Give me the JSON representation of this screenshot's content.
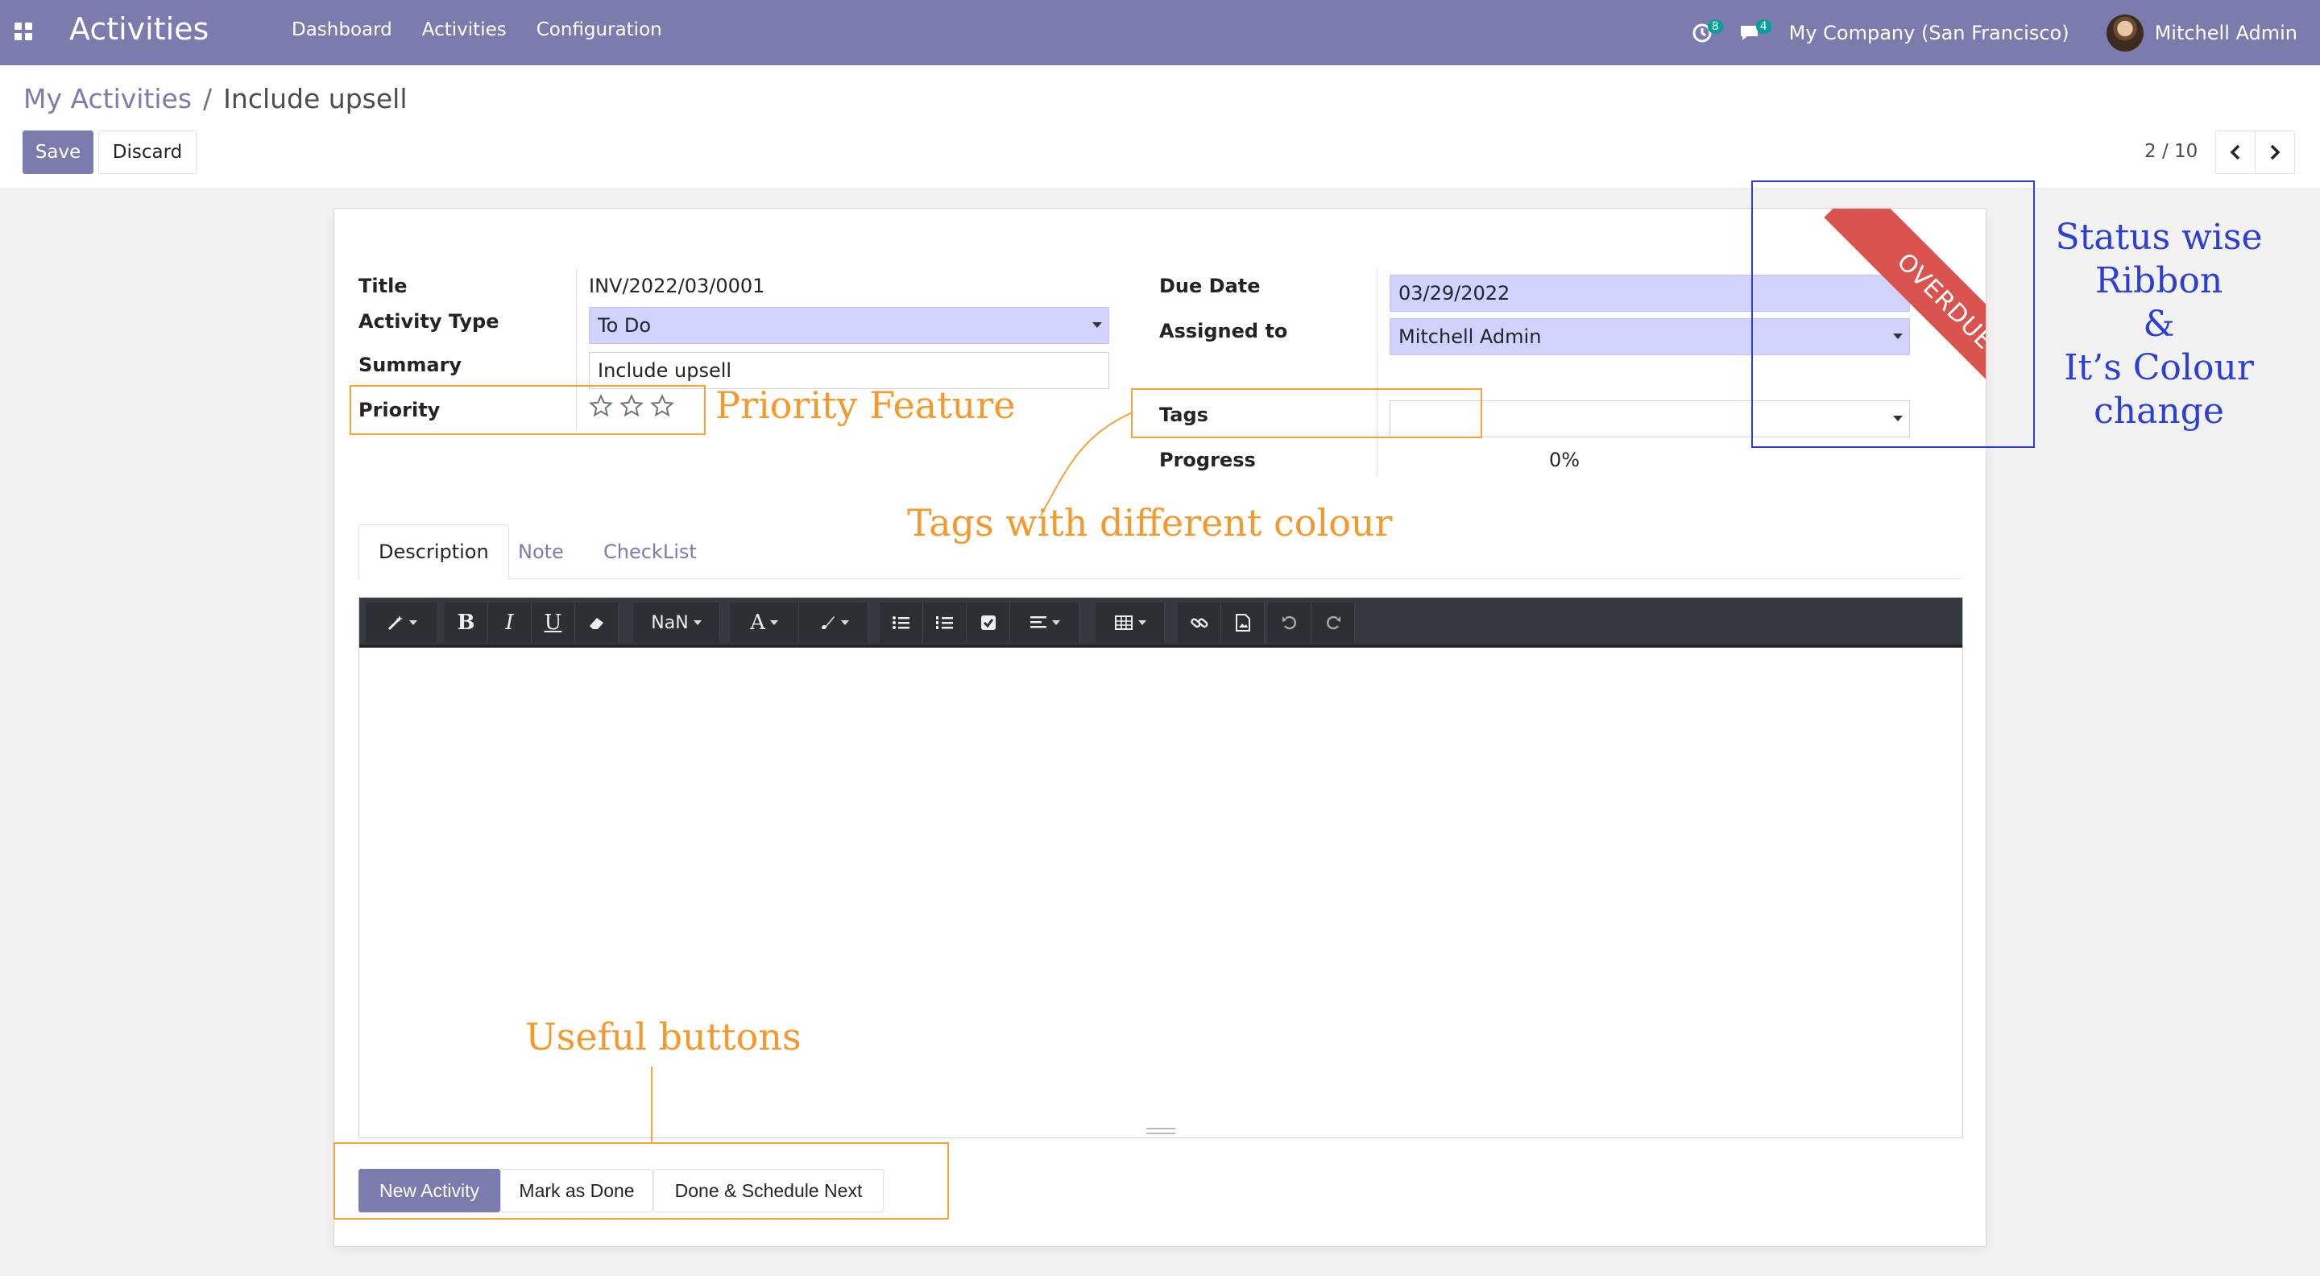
{
  "navbar": {
    "app_title": "Activities",
    "menu": [
      "Dashboard",
      "Activities",
      "Configuration"
    ],
    "activity_badge": "8",
    "message_badge": "4",
    "company": "My Company (San Francisco)",
    "user": "Mitchell Admin"
  },
  "breadcrumb": {
    "parent": "My Activities",
    "separator": "/",
    "current": "Include upsell"
  },
  "control": {
    "save": "Save",
    "discard": "Discard",
    "pager": "2 / 10"
  },
  "form": {
    "title_label": "Title",
    "title_value": "INV/2022/03/0001",
    "activity_type_label": "Activity Type",
    "activity_type_value": "To Do",
    "summary_label": "Summary",
    "summary_value": "Include upsell",
    "priority_label": "Priority",
    "priority_stars": 0,
    "due_date_label": "Due Date",
    "due_date_value": "03/29/2022",
    "assigned_label": "Assigned to",
    "assigned_value": "Mitchell Admin",
    "tags_label": "Tags",
    "tags_value": "",
    "progress_label": "Progress",
    "progress_value": "0%",
    "ribbon": "OVERDUE"
  },
  "tabs": [
    "Description",
    "Note",
    "CheckList"
  ],
  "editor": {
    "font_size": "NaN",
    "font_letter": "A",
    "bold": "B",
    "italic": "I",
    "underline": "U"
  },
  "footer": {
    "new_activity": "New Activity",
    "mark_done": "Mark as Done",
    "done_schedule": "Done & Schedule Next"
  },
  "annotations": {
    "priority": "Priority Feature",
    "tags": "Tags with different colour",
    "buttons": "Useful buttons",
    "ribbon_line1": "Status wise",
    "ribbon_line2": "Ribbon",
    "ribbon_line3": "&",
    "ribbon_line4": "It’s Colour",
    "ribbon_line5": "change"
  },
  "colors": {
    "brand": "#7c7bad",
    "ribbon": "#d9534f",
    "annotation": "#f29a2e",
    "annotation_blue": "#2b3fd6",
    "select_bg": "#d2d2ff"
  }
}
